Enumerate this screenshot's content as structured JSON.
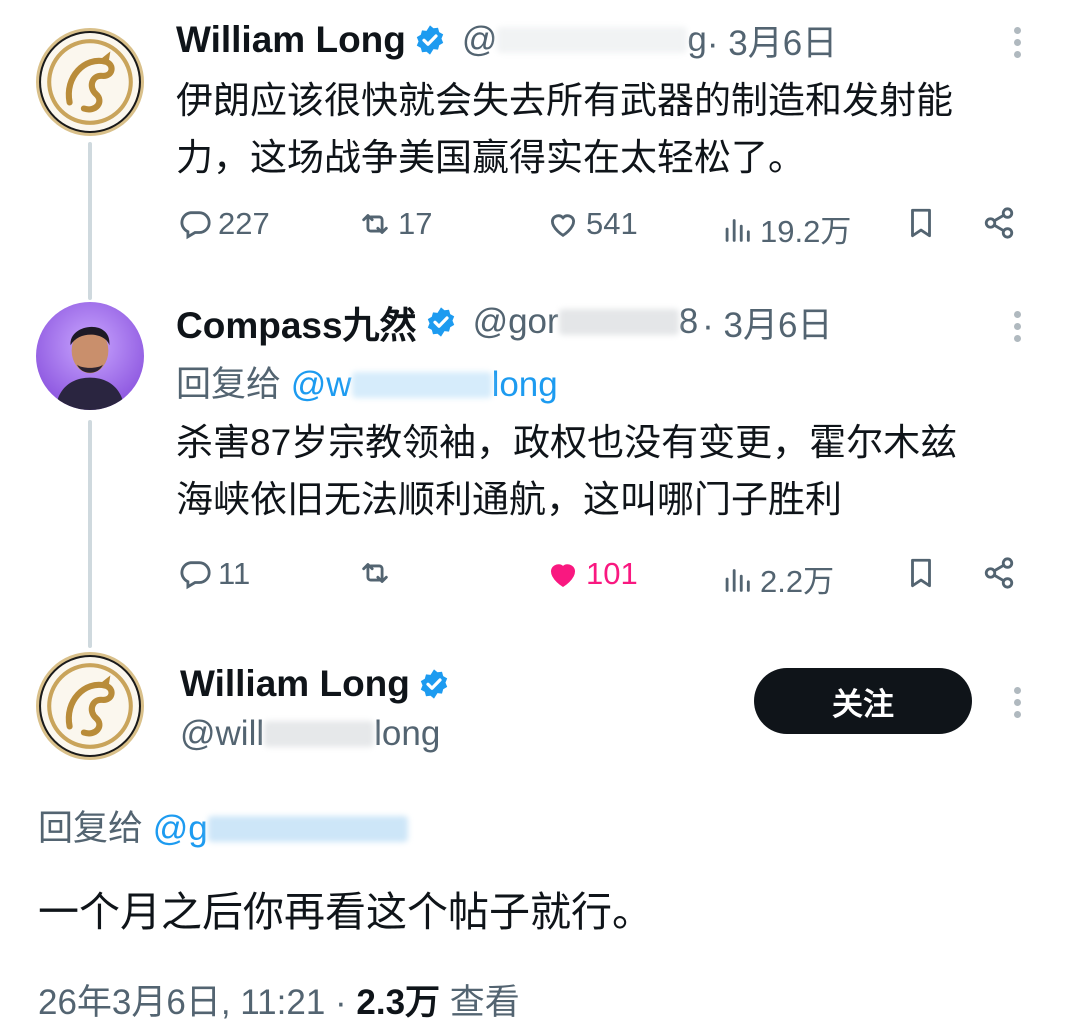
{
  "colors": {
    "accent": "#1d9bf0",
    "like_active": "#f91880",
    "muted": "#536471"
  },
  "tweet1": {
    "name": "William Long",
    "handle_prefix": "@",
    "handle_tail": "g",
    "date": "· 3月6日",
    "text_line1": "伊朗应该很快就会失去所有武器的制造和发射能",
    "text_line2": "力，这场战争美国赢得实在太轻松了。",
    "replies": "227",
    "retweets": "17",
    "likes": "541",
    "views": "19.2万"
  },
  "tweet2": {
    "name": "Compass九然",
    "handle_prefix": "@gor",
    "handle_tail": "8",
    "date": "· 3月6日",
    "replying_label": "回复给",
    "replying_handle": "@w",
    "replying_tail": "long",
    "text_line1": "杀害87岁宗教领袖，政权也没有变更，霍尔木兹",
    "text_line2": "海峡依旧无法顺利通航，这叫哪门子胜利",
    "replies": "11",
    "likes": "101",
    "views": "2.2万"
  },
  "tweet3": {
    "name": "William Long",
    "handle_prefix": "@will",
    "handle_tail": "long",
    "follow_label": "关注",
    "replying_label": "回复给",
    "replying_handle": "@g",
    "text": "一个月之后你再看这个帖子就行。",
    "timestamp": "26年3月6日, 11:21 · ",
    "view_count": "2.3万",
    "view_label": " 查看"
  }
}
